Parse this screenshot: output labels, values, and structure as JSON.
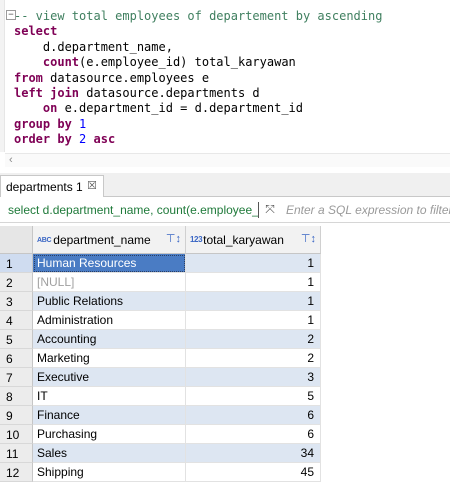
{
  "editor": {
    "lines": [
      "-- view total employees of departement by ascending",
      "select",
      "d.department_name,",
      "count",
      "(e.employee_id) total_karyawan",
      "from",
      " datasource.employees e",
      "left join",
      " datasource.departments d",
      "on",
      " e.department_id = d.department_id",
      "group by",
      "1",
      "order by",
      "2",
      "asc"
    ],
    "fold_marker": "−"
  },
  "scroll": {
    "left_arrow": "‹"
  },
  "results_tab": {
    "label": "departments 1",
    "close": "☒"
  },
  "filter": {
    "query": "select d.department_name, count(e.employee_i",
    "expand_icon": "⤧",
    "placeholder": "Enter a SQL expression to filter results"
  },
  "grid": {
    "columns": [
      {
        "type_badge": "ABC",
        "label": "department_name"
      },
      {
        "type_badge": "123",
        "label": "total_karyawan"
      }
    ],
    "sort_icon": "⊤↕",
    "rows": [
      {
        "n": "1",
        "department_name": "Human Resources",
        "total_karyawan": "1"
      },
      {
        "n": "2",
        "department_name": "[NULL]",
        "total_karyawan": "1"
      },
      {
        "n": "3",
        "department_name": "Public Relations",
        "total_karyawan": "1"
      },
      {
        "n": "4",
        "department_name": "Administration",
        "total_karyawan": "1"
      },
      {
        "n": "5",
        "department_name": "Accounting",
        "total_karyawan": "2"
      },
      {
        "n": "6",
        "department_name": "Marketing",
        "total_karyawan": "2"
      },
      {
        "n": "7",
        "department_name": "Executive",
        "total_karyawan": "3"
      },
      {
        "n": "8",
        "department_name": "IT",
        "total_karyawan": "5"
      },
      {
        "n": "9",
        "department_name": "Finance",
        "total_karyawan": "6"
      },
      {
        "n": "10",
        "department_name": "Purchasing",
        "total_karyawan": "6"
      },
      {
        "n": "11",
        "department_name": "Sales",
        "total_karyawan": "34"
      },
      {
        "n": "12",
        "department_name": "Shipping",
        "total_karyawan": "45"
      }
    ]
  }
}
